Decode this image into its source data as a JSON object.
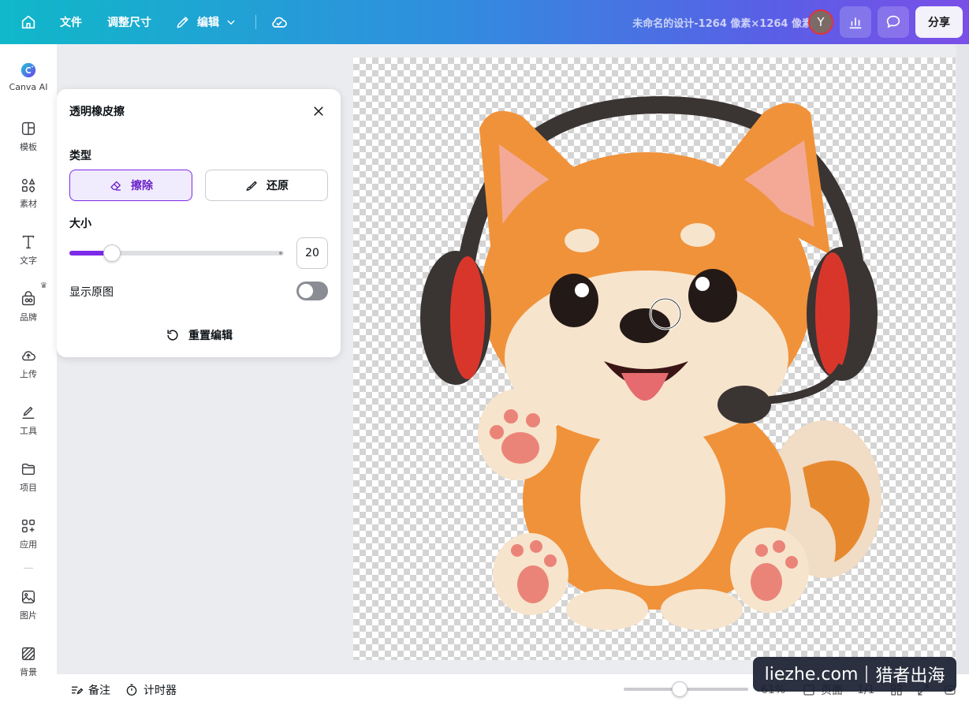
{
  "topbar": {
    "menu_file": "文件",
    "menu_resize": "调整尺寸",
    "menu_edit": "编辑",
    "doc_title": "未命名的设计-1264 像素×1264 像素",
    "avatar_initial": "Y",
    "share_label": "分享"
  },
  "rail": {
    "items": [
      {
        "label": "Canva AI",
        "icon": "canva-ai-icon"
      },
      {
        "label": "模板",
        "icon": "template-icon"
      },
      {
        "label": "素材",
        "icon": "elements-icon"
      },
      {
        "label": "文字",
        "icon": "text-icon"
      },
      {
        "label": "品牌",
        "icon": "brand-icon"
      },
      {
        "label": "上传",
        "icon": "upload-icon"
      },
      {
        "label": "工具",
        "icon": "tools-icon"
      },
      {
        "label": "项目",
        "icon": "folder-icon"
      },
      {
        "label": "应用",
        "icon": "apps-icon"
      },
      {
        "label": "图片",
        "icon": "image-icon"
      },
      {
        "label": "背景",
        "icon": "background-icon"
      }
    ]
  },
  "panel": {
    "title": "透明橡皮擦",
    "type_label": "类型",
    "erase_label": "擦除",
    "restore_label": "还原",
    "size_label": "大小",
    "size_value": "20",
    "size_fraction": 0.2,
    "show_original_label": "显示原图",
    "show_original_on": false,
    "reset_label": "重置编辑"
  },
  "bottombar": {
    "notes_label": "备注",
    "timer_label": "计时器",
    "zoom_value": "61%",
    "pages_label": "页面",
    "page_count": "1/1"
  },
  "watermark": {
    "left": "liezhe.com",
    "right": "猎者出海"
  },
  "colors": {
    "accent": "#7d2ae8",
    "topbar_start": "#10b8c9",
    "topbar_end": "#7a4fe8"
  }
}
